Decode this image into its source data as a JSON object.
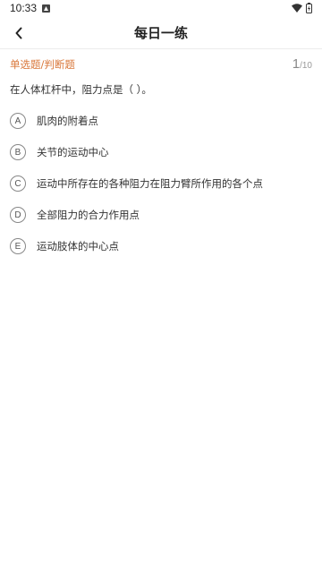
{
  "status": {
    "time": "10:33"
  },
  "header": {
    "title": "每日一练"
  },
  "question": {
    "type_label": "单选题/判断题",
    "current": "1",
    "total": "/10",
    "text": "在人体杠杆中，阻力点是（      ）。",
    "options": [
      {
        "letter": "A",
        "text": "肌肉的附着点"
      },
      {
        "letter": "B",
        "text": "关节的运动中心"
      },
      {
        "letter": "C",
        "text": "运动中所存在的各种阻力在阻力臂所作用的各个点"
      },
      {
        "letter": "D",
        "text": "全部阻力的合力作用点"
      },
      {
        "letter": "E",
        "text": "运动肢体的中心点"
      }
    ]
  },
  "colors": {
    "accent": "#d9773a"
  },
  "icons": {
    "back": "chevron-left-icon",
    "wifi": "wifi-icon",
    "battery": "battery-icon"
  }
}
